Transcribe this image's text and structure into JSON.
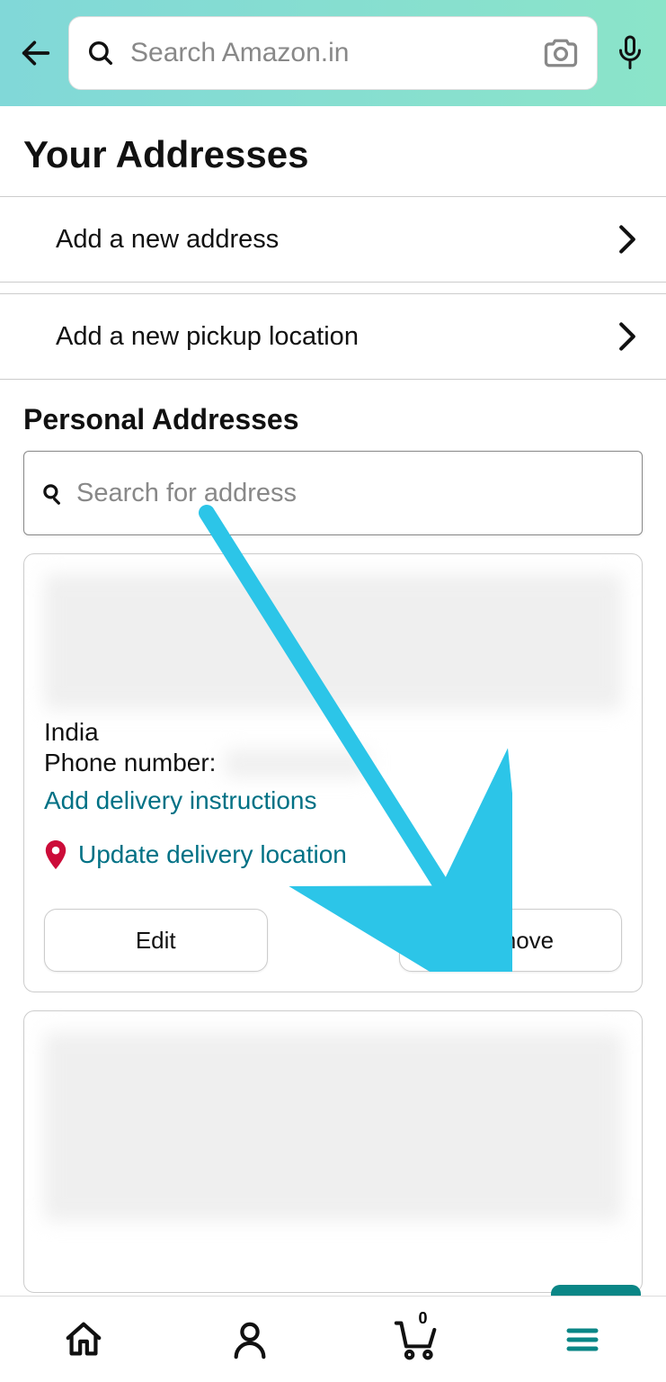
{
  "header": {
    "search_placeholder": "Search Amazon.in"
  },
  "page": {
    "title": "Your Addresses",
    "add_address_label": "Add a new address",
    "add_pickup_label": "Add a new pickup location",
    "section_title": "Personal Addresses",
    "address_search_placeholder": "Search for address"
  },
  "address_card": {
    "country": "India",
    "phone_label": "Phone number:",
    "add_instructions_label": "Add delivery instructions",
    "update_location_label": "Update delivery location",
    "edit_label": "Edit",
    "remove_label": "Remove"
  },
  "bottom_nav": {
    "cart_count": "0"
  }
}
